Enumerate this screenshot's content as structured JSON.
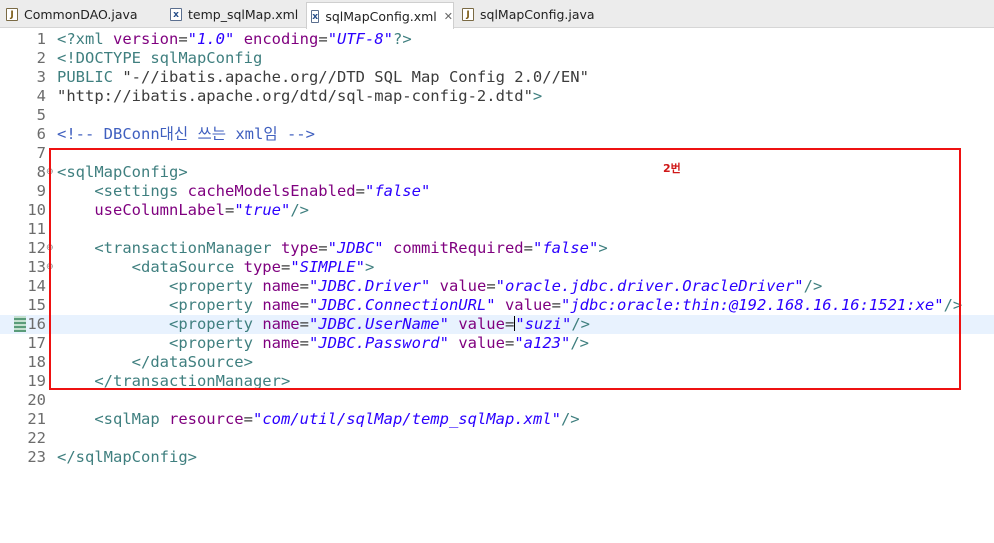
{
  "tabs": [
    {
      "label": "CommonDAO.java",
      "icon": "java-file-icon",
      "type": "J"
    },
    {
      "label": "temp_sqlMap.xml",
      "icon": "xml-file-icon",
      "type": "X"
    },
    {
      "label": "sqlMapConfig.xml",
      "icon": "xml-file-icon",
      "type": "X",
      "active": true,
      "close": "✕"
    },
    {
      "label": "sqlMapConfig.java",
      "icon": "java-file-icon",
      "type": "J"
    }
  ],
  "annotation": {
    "label": "2번",
    "color": "#ee1111"
  },
  "lines": [
    {
      "n": "1",
      "parts": [
        [
          "pi",
          "<?xml "
        ],
        [
          "attr",
          "version"
        ],
        [
          "plain",
          "="
        ],
        [
          "val",
          "\"1.0\""
        ],
        [
          "plain",
          " "
        ],
        [
          "attr",
          "encoding"
        ],
        [
          "plain",
          "="
        ],
        [
          "val",
          "\"UTF-8\""
        ],
        [
          "pi",
          "?>"
        ]
      ]
    },
    {
      "n": "2",
      "parts": [
        [
          "tag",
          "<!DOCTYPE sqlMapConfig"
        ]
      ]
    },
    {
      "n": "3",
      "parts": [
        [
          "tag",
          "PUBLIC "
        ],
        [
          "plain",
          "\"-//ibatis.apache.org//DTD SQL Map Config 2.0//EN\""
        ]
      ]
    },
    {
      "n": "4",
      "parts": [
        [
          "plain",
          "\"http://ibatis.apache.org/dtd/sql-map-config-2.dtd\""
        ],
        [
          "tag",
          ">"
        ]
      ]
    },
    {
      "n": "5",
      "parts": []
    },
    {
      "n": "6",
      "parts": [
        [
          "cmt",
          "<!-- DBConn대신 쓰는 xml임 -->"
        ]
      ]
    },
    {
      "n": "7",
      "parts": []
    },
    {
      "n": "8",
      "fold": true,
      "parts": [
        [
          "tag",
          "<sqlMapConfig>"
        ]
      ]
    },
    {
      "n": "9",
      "parts": [
        [
          "plain",
          "    "
        ],
        [
          "tag",
          "<settings "
        ],
        [
          "attr",
          "cacheModelsEnabled"
        ],
        [
          "plain",
          "="
        ],
        [
          "val",
          "\"false\""
        ]
      ]
    },
    {
      "n": "10",
      "parts": [
        [
          "plain",
          "    "
        ],
        [
          "attr",
          "useColumnLabel"
        ],
        [
          "plain",
          "="
        ],
        [
          "val",
          "\"true\""
        ],
        [
          "tag",
          "/>"
        ]
      ]
    },
    {
      "n": "11",
      "parts": []
    },
    {
      "n": "12",
      "fold": true,
      "parts": [
        [
          "plain",
          "    "
        ],
        [
          "tag",
          "<transactionManager "
        ],
        [
          "attr",
          "type"
        ],
        [
          "plain",
          "="
        ],
        [
          "val",
          "\"JDBC\""
        ],
        [
          "plain",
          " "
        ],
        [
          "attr",
          "commitRequired"
        ],
        [
          "plain",
          "="
        ],
        [
          "val",
          "\"false\""
        ],
        [
          "tag",
          ">"
        ]
      ]
    },
    {
      "n": "13",
      "fold": true,
      "parts": [
        [
          "plain",
          "        "
        ],
        [
          "tag",
          "<dataSource "
        ],
        [
          "attr",
          "type"
        ],
        [
          "plain",
          "="
        ],
        [
          "val",
          "\"SIMPLE\""
        ],
        [
          "tag",
          ">"
        ]
      ]
    },
    {
      "n": "14",
      "parts": [
        [
          "plain",
          "            "
        ],
        [
          "tag",
          "<property "
        ],
        [
          "attr",
          "name"
        ],
        [
          "plain",
          "="
        ],
        [
          "val",
          "\"JDBC.Driver\""
        ],
        [
          "plain",
          " "
        ],
        [
          "attr",
          "value"
        ],
        [
          "plain",
          "="
        ],
        [
          "val",
          "\"oracle.jdbc.driver.OracleDriver\""
        ],
        [
          "tag",
          "/>"
        ]
      ]
    },
    {
      "n": "15",
      "parts": [
        [
          "plain",
          "            "
        ],
        [
          "tag",
          "<property "
        ],
        [
          "attr",
          "name"
        ],
        [
          "plain",
          "="
        ],
        [
          "val",
          "\"JDBC.ConnectionURL\""
        ],
        [
          "plain",
          " "
        ],
        [
          "attr",
          "value"
        ],
        [
          "plain",
          "="
        ],
        [
          "val",
          "\"jdbc:oracle:thin:@192.168.16.16:1521:xe\""
        ],
        [
          "tag",
          "/>"
        ]
      ]
    },
    {
      "n": "16",
      "current": true,
      "parts": [
        [
          "plain",
          "            "
        ],
        [
          "tag",
          "<property "
        ],
        [
          "attr",
          "name"
        ],
        [
          "plain",
          "="
        ],
        [
          "val",
          "\"JDBC.UserName\""
        ],
        [
          "plain",
          " "
        ],
        [
          "attr",
          "value"
        ],
        [
          "plain",
          "="
        ],
        [
          "caret",
          ""
        ],
        [
          "val",
          "\"suzi\""
        ],
        [
          "tag",
          "/>"
        ]
      ]
    },
    {
      "n": "17",
      "parts": [
        [
          "plain",
          "            "
        ],
        [
          "tag",
          "<property "
        ],
        [
          "attr",
          "name"
        ],
        [
          "plain",
          "="
        ],
        [
          "val",
          "\"JDBC.Password\""
        ],
        [
          "plain",
          " "
        ],
        [
          "attr",
          "value"
        ],
        [
          "plain",
          "="
        ],
        [
          "val",
          "\"a123\""
        ],
        [
          "tag",
          "/>"
        ]
      ]
    },
    {
      "n": "18",
      "parts": [
        [
          "plain",
          "        "
        ],
        [
          "tag",
          "</dataSource>"
        ]
      ]
    },
    {
      "n": "19",
      "parts": [
        [
          "plain",
          "    "
        ],
        [
          "tag",
          "</transactionManager>"
        ]
      ]
    },
    {
      "n": "20",
      "parts": []
    },
    {
      "n": "21",
      "parts": [
        [
          "plain",
          "    "
        ],
        [
          "tag",
          "<sqlMap "
        ],
        [
          "attr",
          "resource"
        ],
        [
          "plain",
          "="
        ],
        [
          "val",
          "\"com/util/sqlMap/temp_sqlMap.xml\""
        ],
        [
          "tag",
          "/>"
        ]
      ]
    },
    {
      "n": "22",
      "parts": []
    },
    {
      "n": "23",
      "parts": [
        [
          "tag",
          "</sqlMapConfig>"
        ]
      ]
    }
  ]
}
